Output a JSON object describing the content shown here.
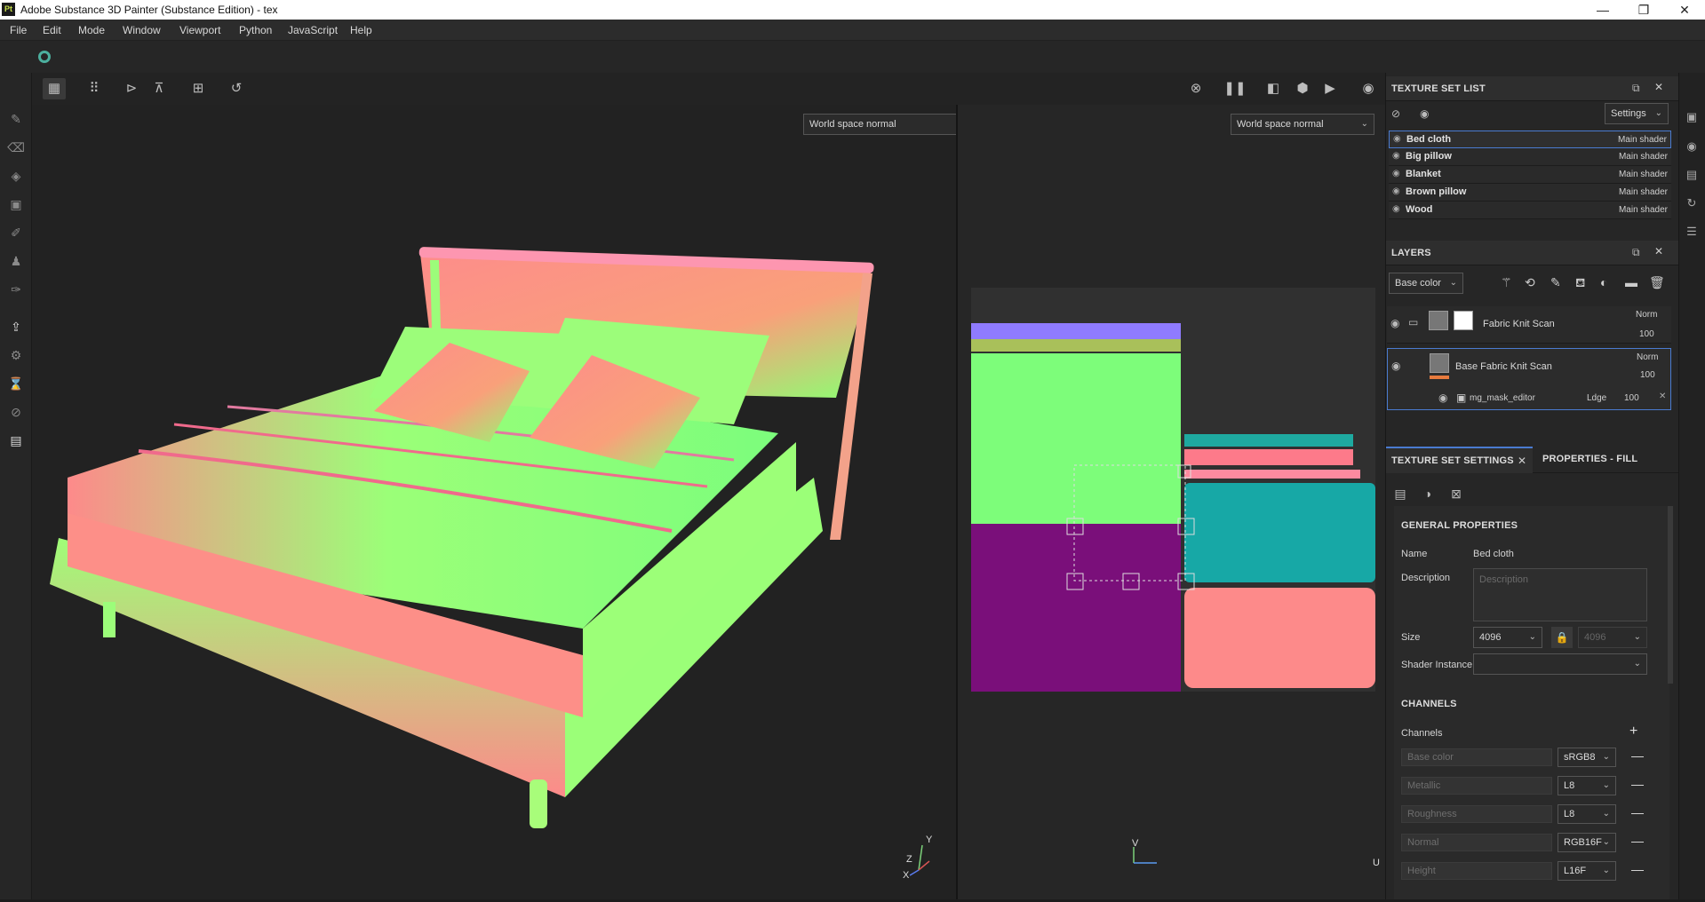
{
  "window": {
    "title": "Adobe Substance 3D Painter (Substance Edition) - tex",
    "app_icon": "Pt",
    "minimize": "—",
    "maximize": "❐",
    "close": "✕"
  },
  "menu": [
    "File",
    "Edit",
    "Mode",
    "Window",
    "Viewport",
    "Python",
    "JavaScript",
    "Help"
  ],
  "viewport": {
    "left_mode": "World space normal",
    "right_mode": "World space normal",
    "axis3d": {
      "y": "Y",
      "z": "Z",
      "x": "X"
    },
    "axis2d": {
      "v": "V",
      "u": "U"
    }
  },
  "texture_set_list": {
    "title": "TEXTURE SET LIST",
    "settings_label": "Settings",
    "items": [
      {
        "name": "Bed cloth",
        "shader": "Main shader"
      },
      {
        "name": "Big pillow",
        "shader": "Main shader"
      },
      {
        "name": "Blanket",
        "shader": "Main shader"
      },
      {
        "name": "Brown pillow",
        "shader": "Main shader"
      },
      {
        "name": "Wood",
        "shader": "Main shader"
      }
    ]
  },
  "layers": {
    "title": "LAYERS",
    "channel": "Base color",
    "rows": [
      {
        "name": "Fabric Knit Scan",
        "blend": "Norm",
        "opacity": "100"
      },
      {
        "name": "Base Fabric Knit Scan",
        "blend": "Norm",
        "opacity": "100"
      },
      {
        "name": "mg_mask_editor",
        "blend": "Ldge",
        "opacity": "100"
      }
    ]
  },
  "tabs": {
    "active": "TEXTURE SET SETTINGS",
    "other": "PROPERTIES - FILL"
  },
  "settings": {
    "general_title": "GENERAL PROPERTIES",
    "name_label": "Name",
    "name_value": "Bed cloth",
    "description_label": "Description",
    "description_placeholder": "Description",
    "size_label": "Size",
    "size_value": "4096",
    "size_value2": "4096",
    "shader_instance_label": "Shader Instance",
    "channels_title": "CHANNELS",
    "channels_label": "Channels",
    "add": "+",
    "channels": [
      {
        "name": "Base color",
        "format": "sRGB8"
      },
      {
        "name": "Metallic",
        "format": "L8"
      },
      {
        "name": "Roughness",
        "format": "L8"
      },
      {
        "name": "Normal",
        "format": "RGB16F"
      },
      {
        "name": "Height",
        "format": "L16F"
      }
    ]
  },
  "colors": {
    "accent": "#4a7bd0",
    "normal_green": "#7dfd7a",
    "normal_pink": "#fd8a8a",
    "normal_purple": "#7a0f7a",
    "normal_blue": "#8f7bff"
  }
}
